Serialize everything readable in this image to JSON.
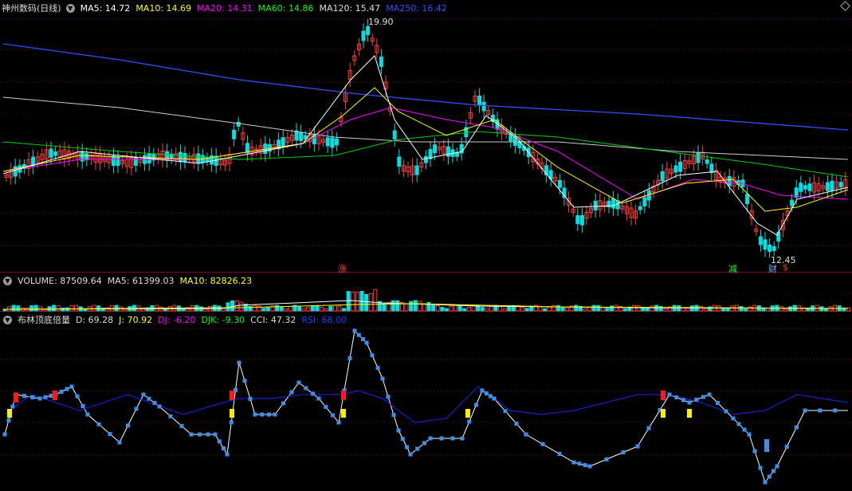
{
  "main": {
    "title": "神州数码(日线)",
    "ma": [
      {
        "label": "MA5: 14.72",
        "color": "#ffffff"
      },
      {
        "label": "MA10: 14.69",
        "color": "#ffff00"
      },
      {
        "label": "MA20: 14.31",
        "color": "#ff00ff"
      },
      {
        "label": "MA60: 14.86",
        "color": "#00ff00"
      },
      {
        "label": "MA120: 15.47",
        "color": "#dddddd"
      },
      {
        "label": "MA250: 16.42",
        "color": "#2f4fff"
      }
    ],
    "high_label": "19.90",
    "low_label": "12.45",
    "markers": [
      {
        "text": "涨",
        "color": "#ff4040"
      },
      {
        "text": "减",
        "color": "#00ff40"
      },
      {
        "text": "财",
        "color": "#6ab0ff"
      },
      {
        "text": "$",
        "color": "#ff3030"
      }
    ]
  },
  "volume": {
    "title": "VOLUME: 87509.64",
    "ma5": "MA5: 61399.03",
    "ma10": "MA10: 82826.23"
  },
  "indicator": {
    "title": "布林顶底倍量",
    "values": [
      {
        "label": "D: 69.28",
        "color": "#dddddd"
      },
      {
        "label": "J: 70.92",
        "color": "#ffff00"
      },
      {
        "label": "DJ: -6.20",
        "color": "#ff00ff"
      },
      {
        "label": "DJK: -9.30",
        "color": "#00ff00"
      },
      {
        "label": "CCI: 47.32",
        "color": "#dddddd"
      },
      {
        "label": "RSI: 68.00",
        "color": "#2040ff"
      }
    ]
  },
  "colors": {
    "up": "#ff3c3c",
    "down": "#00e0e0",
    "background": "#000000",
    "grid": "#8b0000"
  },
  "icons": [
    "caret-down-icon",
    "diamond-icon"
  ]
}
